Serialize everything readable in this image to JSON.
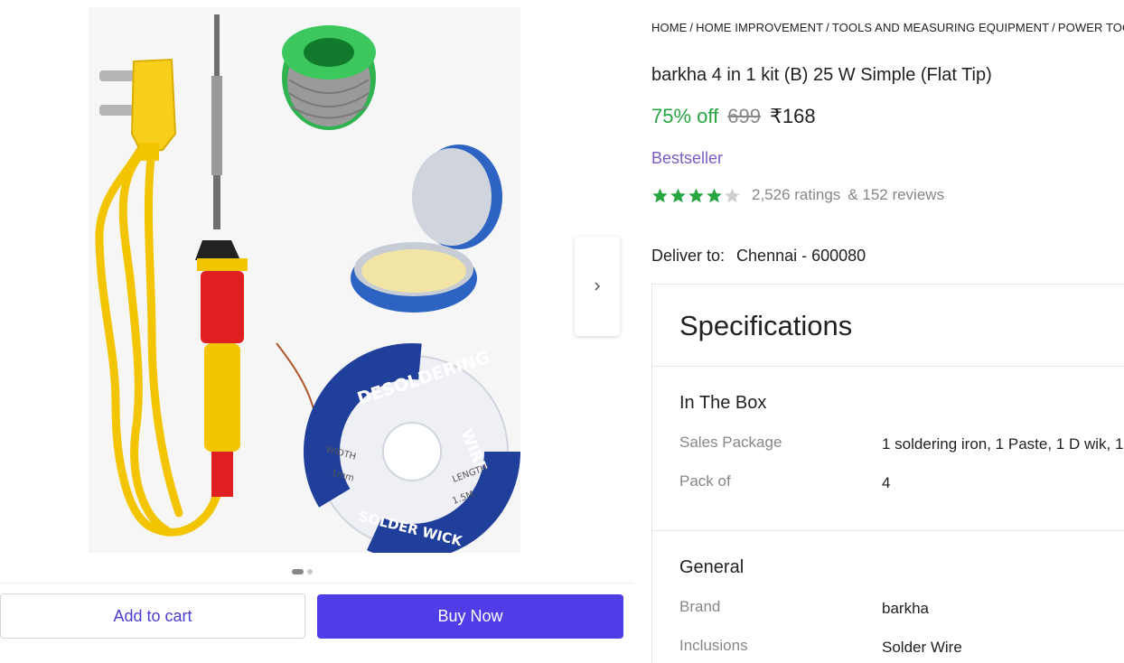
{
  "breadcrumb": [
    {
      "label": "HOME"
    },
    {
      "label": "HOME IMPROVEMENT"
    },
    {
      "label": "TOOLS AND MEASURING EQUIPMENT"
    },
    {
      "label": "POWER TOOLS"
    }
  ],
  "product": {
    "title": "barkha 4 in 1 kit (B) 25 W Simple (Flat Tip)",
    "discount": "75% off",
    "mrp": "699",
    "price": "₹168",
    "badge": "Bestseller",
    "rating_stars": 4,
    "ratings_text": "2,526 ratings",
    "reviews_text": "& 152 reviews"
  },
  "image": {
    "wire_text_top": "DESOLDERING",
    "wire_text_right": "WIRE",
    "wire_text_bottom": "SOLDER WICK",
    "wire_width_label": "WIDTH",
    "wire_width_value": "1mm",
    "wire_length_label": "LENGTH",
    "wire_length_value": "1.5M",
    "slide_count": 2,
    "active_slide": 1
  },
  "actions": {
    "add_to_cart": "Add to cart",
    "buy_now": "Buy Now"
  },
  "delivery": {
    "label": "Deliver to:",
    "location": "Chennai - 600080"
  },
  "specifications": {
    "title": "Specifications",
    "sections": [
      {
        "title": "In The Box",
        "rows": [
          {
            "label": "Sales Package",
            "value": "1 soldering iron, 1 Paste, 1 D wik, 1"
          },
          {
            "label": "Pack of",
            "value": "4"
          }
        ]
      },
      {
        "title": "General",
        "rows": [
          {
            "label": "Brand",
            "value": "barkha"
          },
          {
            "label": "Inclusions",
            "value": "Solder Wire"
          }
        ]
      }
    ]
  },
  "colors": {
    "discount_green": "#26a541",
    "buy_button": "#4f3ee8",
    "cart_text": "#4a3fd1",
    "bestseller_purple": "#7a5bc4",
    "star_filled": "#26a541",
    "star_empty": "#cfcfcf"
  },
  "icons": {
    "next_arrow": "chevron-right-icon",
    "star": "star-icon"
  }
}
